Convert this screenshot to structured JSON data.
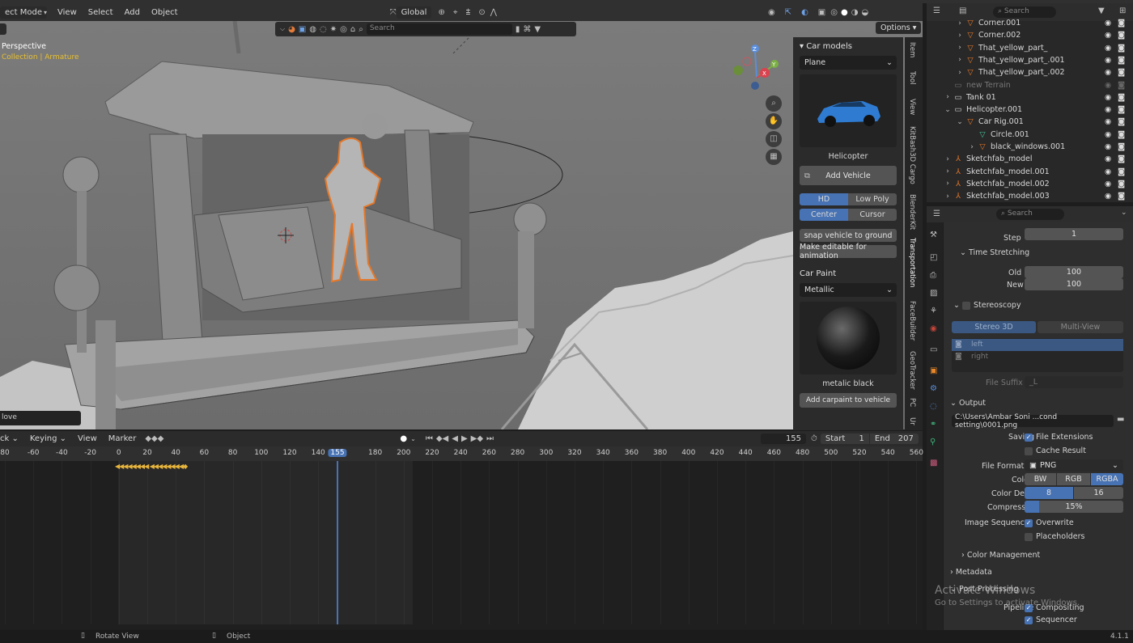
{
  "header": {
    "mode": "ect Mode",
    "menus": [
      "View",
      "Select",
      "Add",
      "Object"
    ],
    "transform_orientation": "Global",
    "options_label": "Options"
  },
  "viewport": {
    "view_name": "Perspective",
    "collection_path": "Collection | Armature",
    "search_placeholder": "Search",
    "move_label": "love"
  },
  "n_panel": {
    "section_car_models": "Car models",
    "model_select": "Plane",
    "vehicle_name": "Helicopter",
    "add_vehicle": "Add Vehicle",
    "hd": "HD",
    "low_poly": "Low Poly",
    "center": "Center",
    "cursor": "Cursor",
    "snap_to_ground": "snap vehicle to ground",
    "make_editable": "Make editable for animation",
    "section_car_paint": "Car Paint",
    "paint_select": "Metallic",
    "paint_name": "metalic black",
    "add_carpaint": "Add carpaint to vehicle",
    "tabs": [
      "Item",
      "Tool",
      "View",
      "KitBash3D Cargo",
      "BlenderKit",
      "Transportation",
      "FaceBuilder",
      "GeoTracker",
      "PC",
      "Ur"
    ]
  },
  "timeline": {
    "menus": [
      "ck",
      "Keying",
      "View",
      "Marker"
    ],
    "current_frame": "155",
    "start_label": "Start",
    "start": "1",
    "end_label": "End",
    "end": "207",
    "ruler_ticks": [
      "80",
      "-60",
      "-40",
      "-20",
      "0",
      "20",
      "40",
      "60",
      "80",
      "100",
      "120",
      "140",
      "155",
      "180",
      "200",
      "220",
      "240",
      "260",
      "280",
      "300",
      "320",
      "340",
      "360",
      "380",
      "400",
      "420",
      "440",
      "460",
      "480",
      "500",
      "520",
      "540",
      "560"
    ]
  },
  "outliner": {
    "search_placeholder": "Search",
    "rows": [
      {
        "label": "Corner.001",
        "indent": 3
      },
      {
        "label": "Corner.002",
        "indent": 3
      },
      {
        "label": "That_yellow_part_",
        "indent": 3
      },
      {
        "label": "That_yellow_part_.001",
        "indent": 3
      },
      {
        "label": "That_yellow_part_.002",
        "indent": 3
      },
      {
        "label": "new Terrain",
        "indent": 2
      },
      {
        "label": "Tank 01",
        "indent": 2
      },
      {
        "label": "Helicopter.001",
        "indent": 2
      },
      {
        "label": "Car Rig.001",
        "indent": 3
      },
      {
        "label": "Circle.001",
        "indent": 4
      },
      {
        "label": "black_windows.001",
        "indent": 4
      },
      {
        "label": "Sketchfab_model",
        "indent": 2
      },
      {
        "label": "Sketchfab_model.001",
        "indent": 2
      },
      {
        "label": "Sketchfab_model.002",
        "indent": 2
      },
      {
        "label": "Sketchfab_model.003",
        "indent": 2
      }
    ]
  },
  "properties": {
    "search_placeholder": "Search",
    "step_label": "Step",
    "step_value": "1",
    "time_stretching": "Time Stretching",
    "old_label": "Old",
    "old_value": "100",
    "new_label": "New",
    "new_value": "100",
    "stereoscopy": "Stereoscopy",
    "stereo_3d": "Stereo 3D",
    "multi_view": "Multi-View",
    "left": "left",
    "right": "right",
    "file_suffix_label": "File Suffix",
    "file_suffix_value": "_L",
    "output": "Output",
    "output_path": "C:\\Users\\Ambar Soni ...cond setting\\0001.png",
    "saving_label": "Saving",
    "file_extensions": "File Extensions",
    "cache_result": "Cache Result",
    "file_format_label": "File Format",
    "file_format": "PNG",
    "color_label": "Color",
    "color_options": [
      "BW",
      "RGB",
      "RGBA"
    ],
    "color_depth_label": "Color Depth",
    "depth_options": [
      "8",
      "16"
    ],
    "compression_label": "Compression",
    "compression": "15%",
    "compression_fraction": 0.15,
    "image_sequence_label": "Image Sequence",
    "overwrite": "Overwrite",
    "placeholders": "Placeholders",
    "color_management": "Color Management",
    "metadata": "Metadata",
    "post_processing": "Post Processing",
    "pipeline_label": "Pipeline",
    "compositing": "Compositing",
    "sequencer": "Sequencer"
  },
  "status_bar": {
    "rotate_view": "Rotate View",
    "object": "Object",
    "version": "4.1.1"
  },
  "watermark": {
    "line1": "Activate Windows",
    "line2": "Go to Settings to activate Windows."
  },
  "colors": {
    "accent_blue": "#4772b3",
    "selection_orange": "#e5782a",
    "keyframe_yellow": "#e8b53c",
    "viewport_gray": "#747474"
  }
}
